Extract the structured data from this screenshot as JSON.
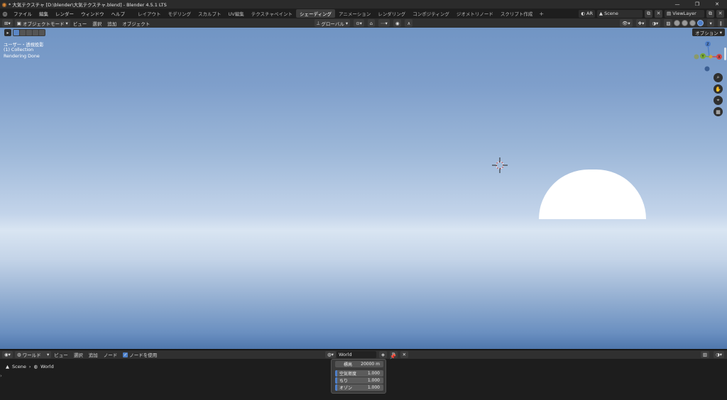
{
  "window": {
    "title": "* 大気テクスチャ [D:\\blender\\大気テクスチャ.blend] - Blender 4.5.1 LTS",
    "controls": [
      "—",
      "❐",
      "✕"
    ]
  },
  "menu": {
    "items": [
      "ファイル",
      "編集",
      "レンダー",
      "ウィンドウ",
      "ヘルプ"
    ],
    "workspaces": [
      "レイアウト",
      "モデリング",
      "スカルプト",
      "UV編集",
      "テクスチャペイント",
      "シェーディング",
      "アニメーション",
      "レンダリング",
      "コンポジティング",
      "ジオメトリノード",
      "スクリプト作成"
    ],
    "active_workspace": "シェーディング",
    "add_workspace": "+",
    "right": {
      "mode": "AR",
      "scene": "Scene",
      "view_layer": "ViewLayer"
    }
  },
  "viewport_header": {
    "mode": "オブジェクトモード",
    "menus": [
      "ビュー",
      "選択",
      "追加",
      "オブジェクト"
    ],
    "orientation": "グローバル"
  },
  "viewport": {
    "overlay_lines": [
      "ユーザー・透視投影",
      "(1) Collection",
      "Rendering Done"
    ],
    "options_label": "オプション",
    "gizmo": {
      "z_label": "Z",
      "y_label": "Y",
      "x_label": "X"
    },
    "colors": {
      "sky_top": "#7195c4",
      "horizon": "#d9e5f2",
      "bottom": "#4f77ad",
      "sun": "#ffffff"
    }
  },
  "node_header": {
    "type": "ワールド",
    "menus": [
      "ビュー",
      "選択",
      "追加",
      "ノード"
    ],
    "use_nodes_label": "ノードを使用",
    "world_name": "World"
  },
  "node_editor": {
    "breadcrumb": [
      "Scene",
      "World"
    ],
    "panel": {
      "altitude_label": "標高",
      "altitude_value": "20000 m",
      "rows": [
        {
          "label": "空気密度",
          "value": "1.000"
        },
        {
          "label": "ちり",
          "value": "1.000"
        },
        {
          "label": "オゾン",
          "value": "1.000"
        }
      ]
    }
  }
}
